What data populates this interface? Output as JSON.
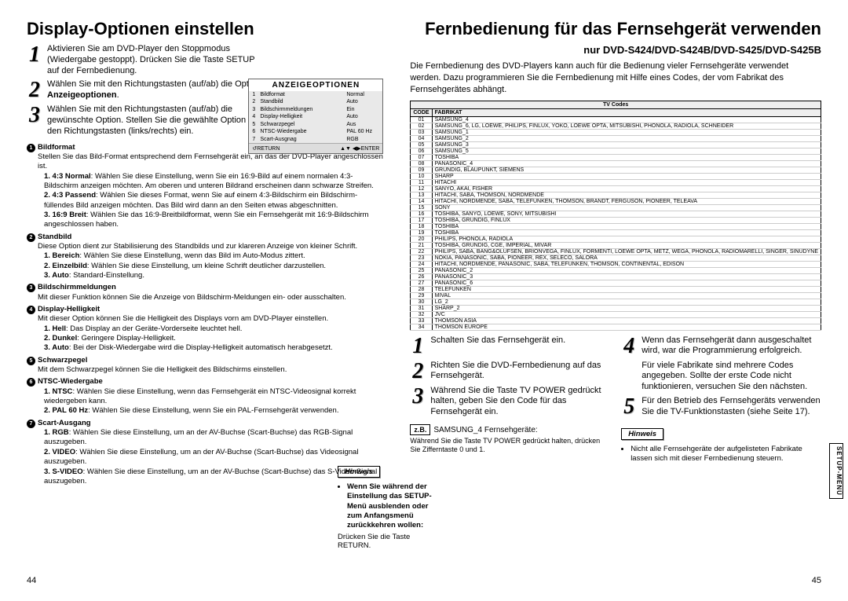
{
  "left": {
    "title": "Display-Optionen einstellen",
    "steps": [
      {
        "n": "1",
        "text": "Aktivieren Sie am DVD-Player den Stoppmodus (Wiedergabe gestoppt). Drücken Sie die Taste SETUP auf der Fernbedienung."
      },
      {
        "n": "2",
        "text_pre": "Wählen Sie mit den Richtungstasten (auf/ab) die Option ",
        "bold": "Anzeigeoptionen",
        "text_post": "."
      },
      {
        "n": "3",
        "text": "Wählen Sie mit den Richtungstasten (auf/ab) die gewünschte Option. Stellen Sie die gewählte Option mit den Richtungstasten (links/rechts) ein."
      }
    ],
    "osd": {
      "title": "ANZEIGEOPTIONEN",
      "rows": [
        {
          "n": "1",
          "l": "Bildformat",
          "v": "Normal"
        },
        {
          "n": "2",
          "l": "Standbild",
          "v": "Auto"
        },
        {
          "n": "3",
          "l": "Bildschirmmeldungen",
          "v": "Ein"
        },
        {
          "n": "4",
          "l": "Display-Helligkeit",
          "v": "Auto"
        },
        {
          "n": "5",
          "l": "Schwarzpegel",
          "v": "Aus"
        },
        {
          "n": "6",
          "l": "NTSC-Wiedergabe",
          "v": "PAL 60 Hz"
        },
        {
          "n": "7",
          "l": "Scart-Ausgnag",
          "v": "RGB"
        }
      ],
      "foot_left": "↺RETURN",
      "foot_right": "▲▼  ◀▶ENTER"
    },
    "details": [
      {
        "n": "1",
        "hd": "Bildformat",
        "body": "Stellen Sie das Bild-Format entsprechend dem Fernsehgerät ein, an das der DVD-Player angeschlossen ist.",
        "subs": [
          {
            "lbl": "1. 4:3 Normal",
            "txt": ": Wählen Sie diese Einstellung, wenn Sie ein 16:9-Bild auf einem normalen 4:3-Bildschirm anzeigen möchten. Am oberen und unteren Bildrand erscheinen dann schwarze Streifen."
          },
          {
            "lbl": "2. 4:3 Passend",
            "txt": ": Wählen Sie dieses Format, wenn Sie auf einem 4:3-Bildschirm ein Bildschirm-füllendes Bild anzeigen möchten. Das Bild wird dann an den Seiten etwas abgeschnitten."
          },
          {
            "lbl": "3. 16:9 Breit",
            "txt": ": Wählen Sie das 16:9-Breitbildformat, wenn Sie ein Fernsehgerät mit 16:9-Bildschirm angeschlossen haben."
          }
        ]
      },
      {
        "n": "2",
        "hd": "Standbild",
        "body": "Diese Option dient zur Stabilisierung des Standbilds und zur klareren Anzeige von kleiner Schrift.",
        "subs": [
          {
            "lbl": "1. Bereich",
            "txt": ": Wählen Sie diese Einstellung, wenn das Bild im Auto-Modus zittert."
          },
          {
            "lbl": "2. Einzelbild",
            "txt": ": Wählen Sie diese Einstellung, um kleine Schrift deutlicher darzustellen."
          },
          {
            "lbl": "3. Auto",
            "txt": ": Standard-Einstellung."
          }
        ]
      },
      {
        "n": "3",
        "hd": "Bildschirmmeldungen",
        "body": "Mit dieser Funktion können Sie die Anzeige von Bildschirm-Meldungen ein- oder ausschalten."
      },
      {
        "n": "4",
        "hd": "Display-Helligkeit",
        "body": "Mit dieser Option können Sie die Helligkeit des Displays vorn am DVD-Player einstellen.",
        "subs": [
          {
            "lbl": "1. Hell",
            "txt": ": Das Display an der Geräte-Vorderseite leuchtet hell."
          },
          {
            "lbl": "2. Dunkel",
            "txt": ": Geringere Display-Helligkeit."
          },
          {
            "lbl": "3. Auto",
            "txt": ": Bei der Disk-Wiedergabe wird die Display-Helligkeit automatisch herabgesetzt."
          }
        ]
      },
      {
        "n": "5",
        "hd": "Schwarzpegel",
        "body": "Mit dem Schwarzpegel können Sie die Helligkeit des Bildschirms einstellen."
      },
      {
        "n": "6",
        "hd": "NTSC-Wiedergabe",
        "body": "",
        "subs": [
          {
            "lbl": "1. NTSC",
            "txt": ": Wählen Sie diese Einstellung, wenn das Fernsehgerät ein NTSC-Videosignal korrekt wiedergeben kann."
          },
          {
            "lbl": "2. PAL 60 Hz",
            "txt": ": Wählen Sie diese Einstellung, wenn Sie ein PAL-Fernsehgerät verwenden."
          }
        ]
      },
      {
        "n": "7",
        "hd": "Scart-Ausgang",
        "body": "",
        "subs": [
          {
            "lbl": "1. RGB",
            "txt": ": Wählen Sie diese Einstellung, um an der AV-Buchse (Scart-Buchse) das RGB-Signal auszugeben."
          },
          {
            "lbl": "2. VIDEO",
            "txt": ": Wählen Sie diese Einstellung, um an der AV-Buchse (Scart-Buchse) das Videosignal auszugeben."
          },
          {
            "lbl": "3. S-VIDEO",
            "txt": ": Wählen Sie diese Einstellung, um an der AV-Buchse (Scart-Buchse) das S-Video-Signal auszugeben."
          }
        ]
      }
    ],
    "hinweis": {
      "tag": "Hinweis",
      "bullets": [
        "Wenn Sie während der Einstellung das SETUP-Menü ausblenden oder zum Anfangsmenü zurückkehren wollen:"
      ],
      "tail": "Drücken Sie die Taste RETURN."
    },
    "page": "44"
  },
  "right": {
    "title": "Fernbedienung für das Fernsehgerät verwenden",
    "subtitle": "nur DVD-S424/DVD-S424B/DVD-S425/DVD-S425B",
    "intro": "Die Fernbedienung des DVD-Players kann auch für die Bedienung vieler Fernsehgeräte verwendet werden. Dazu programmieren Sie die Fernbedienung mit Hilfe eines Codes, der vom Fabrikat des Fernsehgerätes abhängt.",
    "table": {
      "title": "TV  Codes",
      "col_code": "CODE",
      "col_fab": "FABRIKAT",
      "rows": [
        {
          "c": "01",
          "f": "SAMSUNG_4"
        },
        {
          "c": "02",
          "f": "SAMSUNG_6, LG, LOEWE, PHILIPS, FINLUX, YOKO, LOEWE OPTA, MITSUBISHI, PHONOLA, RADIOLA, SCHNEIDER"
        },
        {
          "c": "03",
          "f": "SAMSUNG_1"
        },
        {
          "c": "04",
          "f": "SAMSUNG_2"
        },
        {
          "c": "05",
          "f": "SAMSUNG_3"
        },
        {
          "c": "06",
          "f": "SAMSUNG_5"
        },
        {
          "c": "07",
          "f": "TOSHIBA"
        },
        {
          "c": "08",
          "f": "PANASONIC_4"
        },
        {
          "c": "09",
          "f": "GRUNDIG, BLAUPUNKT, SIEMENS"
        },
        {
          "c": "10",
          "f": "SHARP"
        },
        {
          "c": "11",
          "f": "HITACHI"
        },
        {
          "c": "12",
          "f": "SANYO, AKAI, FISHER"
        },
        {
          "c": "13",
          "f": "HITACHI, SABA, THOMSON, NORDMENDE"
        },
        {
          "c": "14",
          "f": "HITACHI, NORDMENDE, SABA, TELEFUNKEN, THOMSON, BRANDT, FERGUSON, PIONEER, TELEAVA"
        },
        {
          "c": "15",
          "f": "SONY"
        },
        {
          "c": "16",
          "f": "TOSHIBA, SANYO, LOEWE, SONY, MITSUBISHI"
        },
        {
          "c": "17",
          "f": "TOSHIBA, GRUNDIG, FINLUX"
        },
        {
          "c": "18",
          "f": "TOSHIBA"
        },
        {
          "c": "19",
          "f": "TOSHIBA"
        },
        {
          "c": "20",
          "f": "PHILIPS, PHONOLA, RADIOLA"
        },
        {
          "c": "21",
          "f": "TOSHIBA, GRUNDIG, CGE, IMPERIAL, MIVAR"
        },
        {
          "c": "22",
          "f": "PHILIPS, SABA, BANG&OLUFSEN, BRIONVEGA, FINLUX, FORMENTI, LOEWE OPTA, METZ, WEGA, PHONOLA, RADIOMARELLI, SINGER, SINUDYNE"
        },
        {
          "c": "23",
          "f": "NOKIA, PANASONIC, SABA, PIONEER, REX, SELECO, SALORA"
        },
        {
          "c": "24",
          "f": "HITACHI, NORDMENDE, PANASONIC, SABA, TELEFUNKEN, THOMSON, CONTINENTAL, EDISON"
        },
        {
          "c": "25",
          "f": "PANASONIC_2"
        },
        {
          "c": "26",
          "f": "PANASONIC_3"
        },
        {
          "c": "27",
          "f": "PANASONIC_6"
        },
        {
          "c": "28",
          "f": "TELEFUNKEN"
        },
        {
          "c": "29",
          "f": "MIVAL"
        },
        {
          "c": "30",
          "f": "LG_2"
        },
        {
          "c": "31",
          "f": "SHARP_2"
        },
        {
          "c": "32",
          "f": "JVC"
        },
        {
          "c": "33",
          "f": "THOMSON ASIA"
        },
        {
          "c": "34",
          "f": "THOMSON EUROPE"
        }
      ]
    },
    "steps_left": [
      {
        "n": "1",
        "t": "Schalten Sie das Fernsehgerät ein."
      },
      {
        "n": "2",
        "t": "Richten Sie die DVD-Fernbedienung auf das Fernsehgerät."
      },
      {
        "n": "3",
        "t": "Während Sie die Taste TV POWER gedrückt halten, geben Sie den Code für das Fernsehgerät ein."
      }
    ],
    "eg_box": "z.B.",
    "eg_text": "SAMSUNG_4 Fernsehgeräte:",
    "eg_note": "Während Sie die Taste TV POWER gedrückt halten, drücken Sie Zifferntaste 0 und 1.",
    "steps_right": [
      {
        "n": "4",
        "t": "Wenn das Fernsehgerät dann ausgeschaltet wird, war die Programmierung erfolgreich."
      },
      {
        "n": "",
        "t": "Für viele Fabrikate sind mehrere Codes angegeben. Sollte der erste Code nicht funktionieren, versuchen Sie den nächsten."
      },
      {
        "n": "5",
        "t": "Für den Betrieb des Fernsehgeräts verwenden Sie die TV-Funktionstasten (siehe Seite 17)."
      }
    ],
    "hinweis": {
      "tag": "Hinweis",
      "bullet": "Nicht alle Fernsehgeräte der aufgelisteten Fabrikate lassen sich mit dieser Fernbedienung steuern."
    },
    "side_tab": "SETUP-MENÜ",
    "page": "45"
  }
}
